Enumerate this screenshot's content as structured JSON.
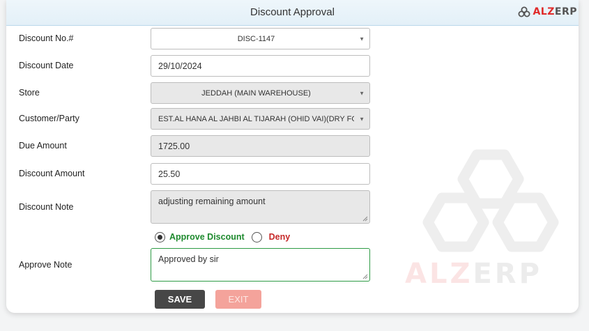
{
  "header": {
    "title": "Discount Approval",
    "logo": {
      "prefix": "ALZ",
      "suffix": "ERP",
      "icon": "three-ring-logo-icon"
    }
  },
  "form": {
    "discount_no": {
      "label": "Discount No.#",
      "value": "DISC-1147"
    },
    "discount_date": {
      "label": "Discount Date",
      "value": "29/10/2024"
    },
    "store": {
      "label": "Store",
      "value": "JEDDAH (MAIN WAREHOUSE)"
    },
    "customer": {
      "label": "Customer/Party",
      "value": "EST.AL HANA AL JAHBI AL TIJARAH (OHID VAI)(DRY FOOD)"
    },
    "due_amount": {
      "label": "Due Amount",
      "value": "1725.00"
    },
    "discount_amount": {
      "label": "Discount Amount",
      "value": "25.50"
    },
    "discount_note": {
      "label": "Discount Note",
      "value": "adjusting remaining amount"
    },
    "decision": {
      "approve_label": "Approve Discount",
      "deny_label": "Deny",
      "selected": "approve"
    },
    "approve_note": {
      "label": "Approve Note",
      "value": "Approved by sir"
    }
  },
  "buttons": {
    "save": "SAVE",
    "exit": "EXIT"
  },
  "watermark": {
    "text": "ALZERP"
  },
  "colors": {
    "header_bg": "#e3f0f8",
    "save_bg": "#474747",
    "exit_bg": "#f4a39b",
    "approve_text": "#1e8a2e",
    "deny_text": "#c62828",
    "brand_red": "#e02b2b"
  }
}
